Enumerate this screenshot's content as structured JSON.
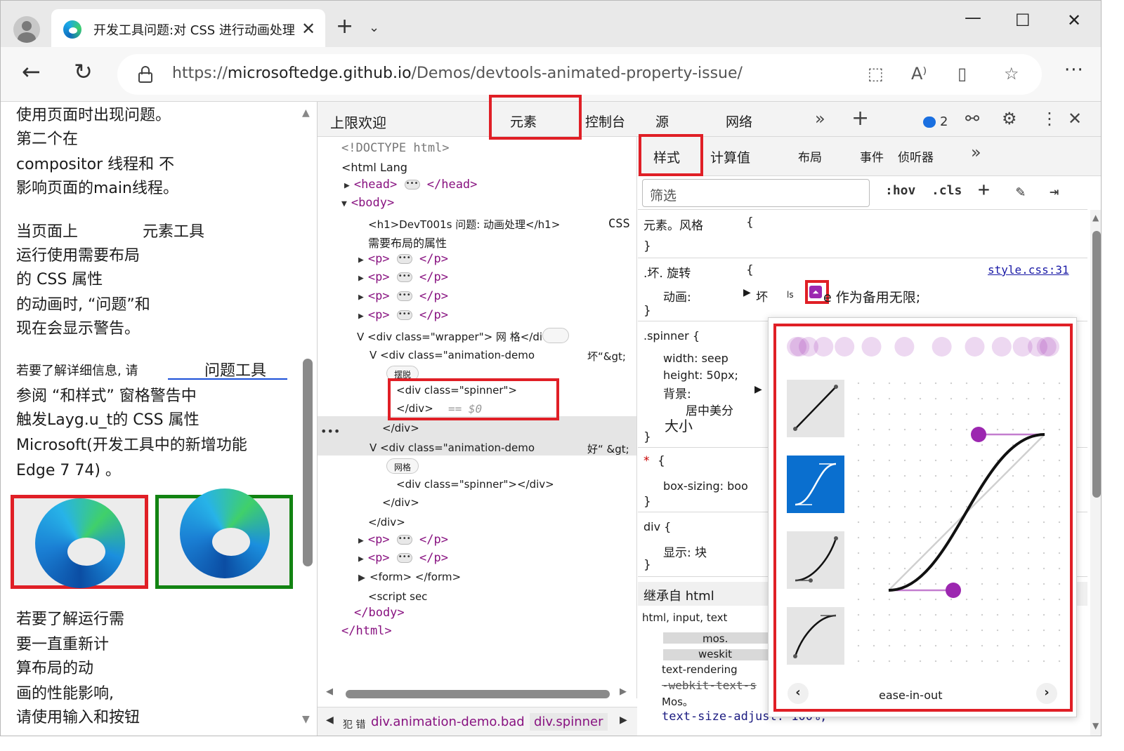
{
  "browser": {
    "tab_title": "开发工具问题:对 CSS 进行动画处理",
    "url_prefix": "https://",
    "url_host": "microsoftedge.github.io",
    "url_path": "/Demos/devtools-animated-property-issue/"
  },
  "page": {
    "lines": [
      "使用页面时出现问题。",
      "第二个在",
      "compositor 线程和 不",
      "影响页面的main线程。",
      "当页面上",
      "元素工具",
      "运行使用需要布局",
      "的 CSS 属性",
      "的动画时, “问题”和",
      "现在会显示警告。",
      "若要了解详细信息, 请",
      "问题工具",
      "参阅 “和样式” 窗格警告中",
      "触发Layg.u_t的 CSS 属性",
      "Microsoft(开发工具中的新增功能",
      "Edge 7 74) 。",
      "若要了解运行需",
      "要一直重新计",
      "算布局的动",
      "画的性能影响,",
      "请使用输入和按钮"
    ]
  },
  "devtools": {
    "title": "上限欢迎",
    "tabs": [
      "元素",
      "控制台",
      "源",
      "网络"
    ],
    "issues_count": "2",
    "tree": {
      "doctype": "<!DOCTYPE html>",
      "html_open": "<html Lang",
      "head": "<head>",
      "head_close": "</head>",
      "body": "<body>",
      "h1": "<h1>DevT001s 问题: 动画处理</h1>",
      "css_tag": "CSS",
      "h1_cont": "需要布局的属性",
      "p_open": "<p>",
      "p_close": "</p>",
      "wrapper": "V <div class=\"wrapper\"> 网 格</div>",
      "anim_demo_1": "V <div class=\"animation-demo",
      "anim_demo_1_tail": "坏“&gt;",
      "pill_1": "摆脱",
      "spinner_open": "<div class=\"spinner\">",
      "div_close": "</div>",
      "dollar0": "== $0",
      "anim_demo_2": "V <div class=\"animation-demo",
      "anim_demo_2_tail": "好“ &gt;",
      "pill_2": "网格",
      "spinner_full": "<div class=\"spinner\"></div>",
      "form": "<form> </form>",
      "script": "<script sec",
      "body_close": "</body>",
      "html_close": "</html>"
    },
    "breadcrumbs": [
      "犯 错",
      "div.animation-demo.bad",
      "div.spinner"
    ],
    "styles": {
      "sub_tabs": [
        "样式",
        "计算值",
        "布局",
        "事件",
        "侦听器"
      ],
      "filter_placeholder": "筛选",
      "hov": ":hov",
      "cls": ".cls",
      "element_style": "元素。风格",
      "open_brace": "{",
      "close_brace": "}",
      "bad_spin_selector": ".坏. 旋转",
      "source_link": "style.css:31",
      "animation_prop": "动画:",
      "animation_value_1": "坏",
      "animation_value_2": "ls",
      "animation_value_3": "e 作为备用无限;",
      "spinner_selector": ".spinner {",
      "width_decl": "width: seep",
      "height_decl": "height: 50px;",
      "bg_decl": "背景:",
      "center_text": "居中美分",
      "size_text": "大小",
      "star_selector": "*",
      "box_sizing": "box-sizing: boo",
      "div_selector": "div {",
      "display_decl": "显示: 块",
      "inherited": "继承自 html",
      "inherited_sel": "html,  input,  text",
      "moz": "mos.",
      "webkit": "weskit",
      "text_rendering": "text-rendering",
      "webkit_text_size": "-webkit-text-s",
      "mos2": "Mos。",
      "text_size_adjust": "text-size-adjust: 100%;"
    },
    "easing": {
      "preset_label": "ease-in-out",
      "curve_color": "#9c27b0"
    }
  }
}
